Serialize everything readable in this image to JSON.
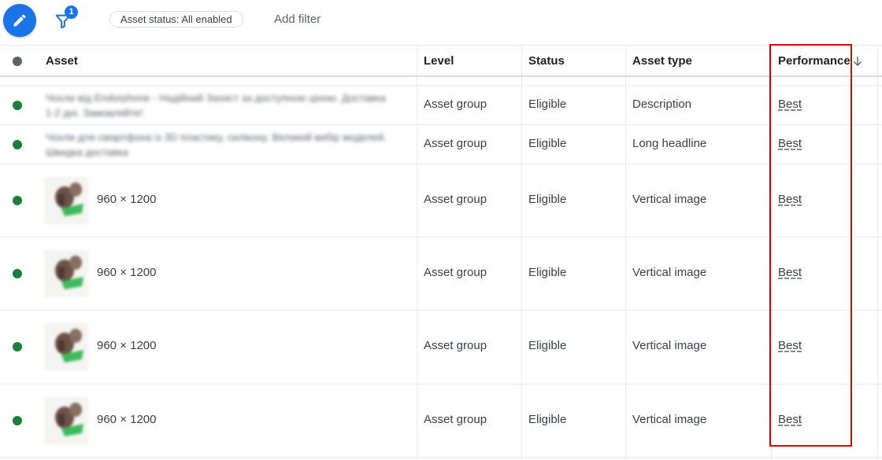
{
  "toolbar": {
    "edit_icon": "pencil-icon",
    "filter_icon": "filter-icon",
    "filter_badge": "1",
    "chip_label": "Asset status: All enabled",
    "add_filter_label": "Add filter"
  },
  "table": {
    "headers": {
      "asset": "Asset",
      "level": "Level",
      "status": "Status",
      "asset_type": "Asset type",
      "performance": "Performance"
    },
    "sort_icon": "arrow-down-icon",
    "rows": [
      {
        "asset_text": "Чохли від Endorphone - Надійний Захист за доступною ціною. Доставка 1-2 дні. Замовляйте!",
        "level": "Asset group",
        "status": "Eligible",
        "asset_type": "Description",
        "performance": "Best"
      },
      {
        "asset_text": "Чохли для смартфона із 3D пластику, силікону. Великий вибір моделей. Швидка доставка",
        "level": "Asset group",
        "status": "Eligible",
        "asset_type": "Long headline",
        "performance": "Best"
      },
      {
        "asset_dims": "960 × 1200",
        "level": "Asset group",
        "status": "Eligible",
        "asset_type": "Vertical image",
        "performance": "Best"
      },
      {
        "asset_dims": "960 × 1200",
        "level": "Asset group",
        "status": "Eligible",
        "asset_type": "Vertical image",
        "performance": "Best"
      },
      {
        "asset_dims": "960 × 1200",
        "level": "Asset group",
        "status": "Eligible",
        "asset_type": "Vertical image",
        "performance": "Best"
      },
      {
        "asset_dims": "960 × 1200",
        "level": "Asset group",
        "status": "Eligible",
        "asset_type": "Vertical image",
        "performance": "Best"
      }
    ]
  },
  "colors": {
    "accent": "#1a73e8",
    "status_enabled": "#188038",
    "highlight": "#e00000"
  }
}
